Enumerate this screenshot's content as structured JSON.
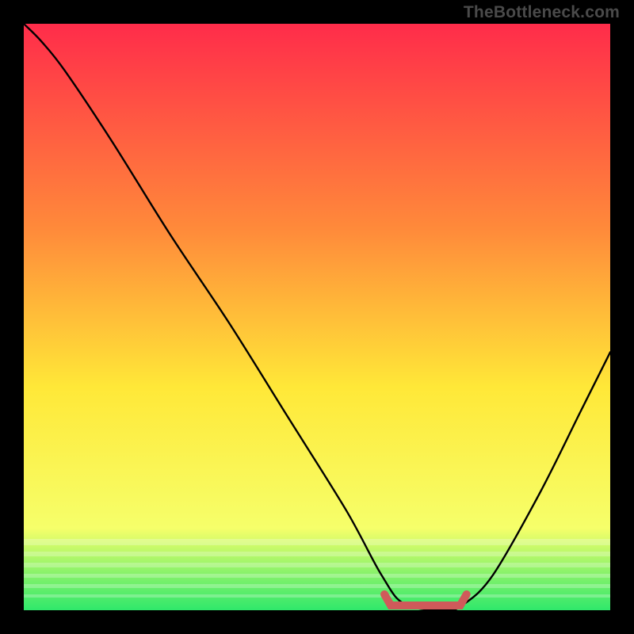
{
  "attribution": "TheBottleneck.com",
  "colors": {
    "frame": "#000000",
    "gradient_top": "#ff2c4a",
    "gradient_mid1": "#ff8a3a",
    "gradient_mid2": "#ffe838",
    "gradient_low": "#f6ff6a",
    "gradient_bottom": "#2fe86b",
    "curve": "#000000",
    "marker": "#cf5a5a"
  },
  "chart_data": {
    "type": "line",
    "title": "",
    "xlabel": "",
    "ylabel": "",
    "xlim": [
      0,
      1
    ],
    "ylim": [
      0,
      1
    ],
    "series": [
      {
        "name": "bottleneck-curve",
        "x": [
          0.0,
          0.03,
          0.07,
          0.15,
          0.25,
          0.35,
          0.45,
          0.55,
          0.61,
          0.65,
          0.72,
          0.75,
          0.8,
          0.88,
          0.95,
          1.0
        ],
        "values": [
          1.0,
          0.97,
          0.92,
          0.8,
          0.64,
          0.49,
          0.33,
          0.17,
          0.06,
          0.01,
          0.0,
          0.01,
          0.06,
          0.2,
          0.34,
          0.44
        ]
      }
    ],
    "marker": {
      "name": "optimal-range",
      "x_start": 0.615,
      "x_end": 0.755,
      "y": 0.0
    }
  }
}
